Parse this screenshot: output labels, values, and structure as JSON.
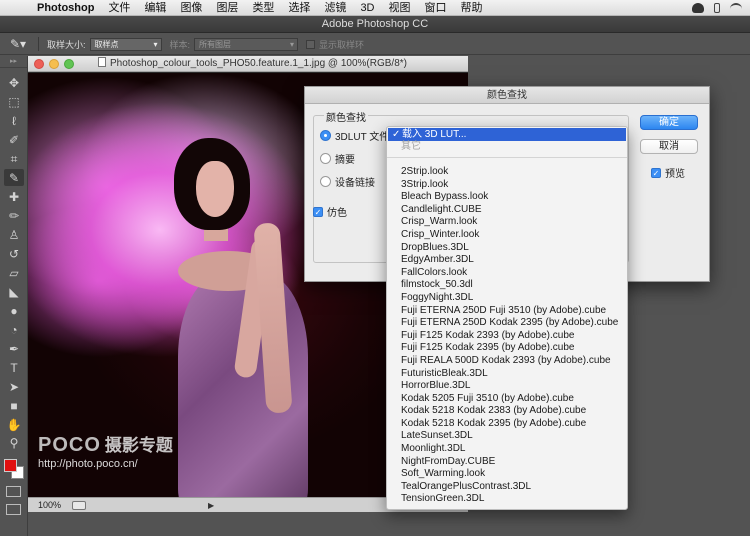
{
  "menubar": {
    "app": "Photoshop",
    "items": [
      "文件",
      "编辑",
      "图像",
      "图层",
      "类型",
      "选择",
      "滤镜",
      "3D",
      "视图",
      "窗口",
      "帮助"
    ]
  },
  "app_title": "Adobe Photoshop CC",
  "options_bar": {
    "sample_size_label": "取样大小:",
    "sample_size_value": "取样点",
    "sample_label": "样本:",
    "sample_value": "所有图层",
    "show_ring_label": "显示取样环"
  },
  "colors": {
    "foreground": "#e01010",
    "background": "#ffffff",
    "accent": "#2e63d6"
  },
  "document": {
    "title": "Photoshop_colour_tools_PHO50.feature.1_1.jpg @ 100%(RGB/8*)",
    "zoom": "100%"
  },
  "watermark": {
    "logo": "POCO",
    "cn": "摄影专题",
    "url": "http://photo.poco.cn/"
  },
  "dialog": {
    "title": "颜色查找",
    "group_title": "颜色查找",
    "options": [
      "3DLUT 文件",
      "摘要",
      "设备链接"
    ],
    "dither_label": "仿色",
    "ok_label": "确定",
    "cancel_label": "取消",
    "preview_label": "预览"
  },
  "dropdown": {
    "selected": "载入 3D LUT...",
    "other": "其它",
    "items": [
      "2Strip.look",
      "3Strip.look",
      "Bleach Bypass.look",
      "Candlelight.CUBE",
      "Crisp_Warm.look",
      "Crisp_Winter.look",
      "DropBlues.3DL",
      "EdgyAmber.3DL",
      "FallColors.look",
      "filmstock_50.3dl",
      "FoggyNight.3DL",
      "Fuji ETERNA 250D Fuji 3510 (by Adobe).cube",
      "Fuji ETERNA 250D Kodak 2395 (by Adobe).cube",
      "Fuji F125 Kodak 2393 (by Adobe).cube",
      "Fuji F125 Kodak 2395 (by Adobe).cube",
      "Fuji REALA 500D Kodak 2393 (by Adobe).cube",
      "FuturisticBleak.3DL",
      "HorrorBlue.3DL",
      "Kodak 5205 Fuji 3510 (by Adobe).cube",
      "Kodak 5218 Kodak 2383 (by Adobe).cube",
      "Kodak 5218 Kodak 2395 (by Adobe).cube",
      "LateSunset.3DL",
      "Moonlight.3DL",
      "NightFromDay.CUBE",
      "Soft_Warming.look",
      "TealOrangePlusContrast.3DL",
      "TensionGreen.3DL"
    ]
  }
}
